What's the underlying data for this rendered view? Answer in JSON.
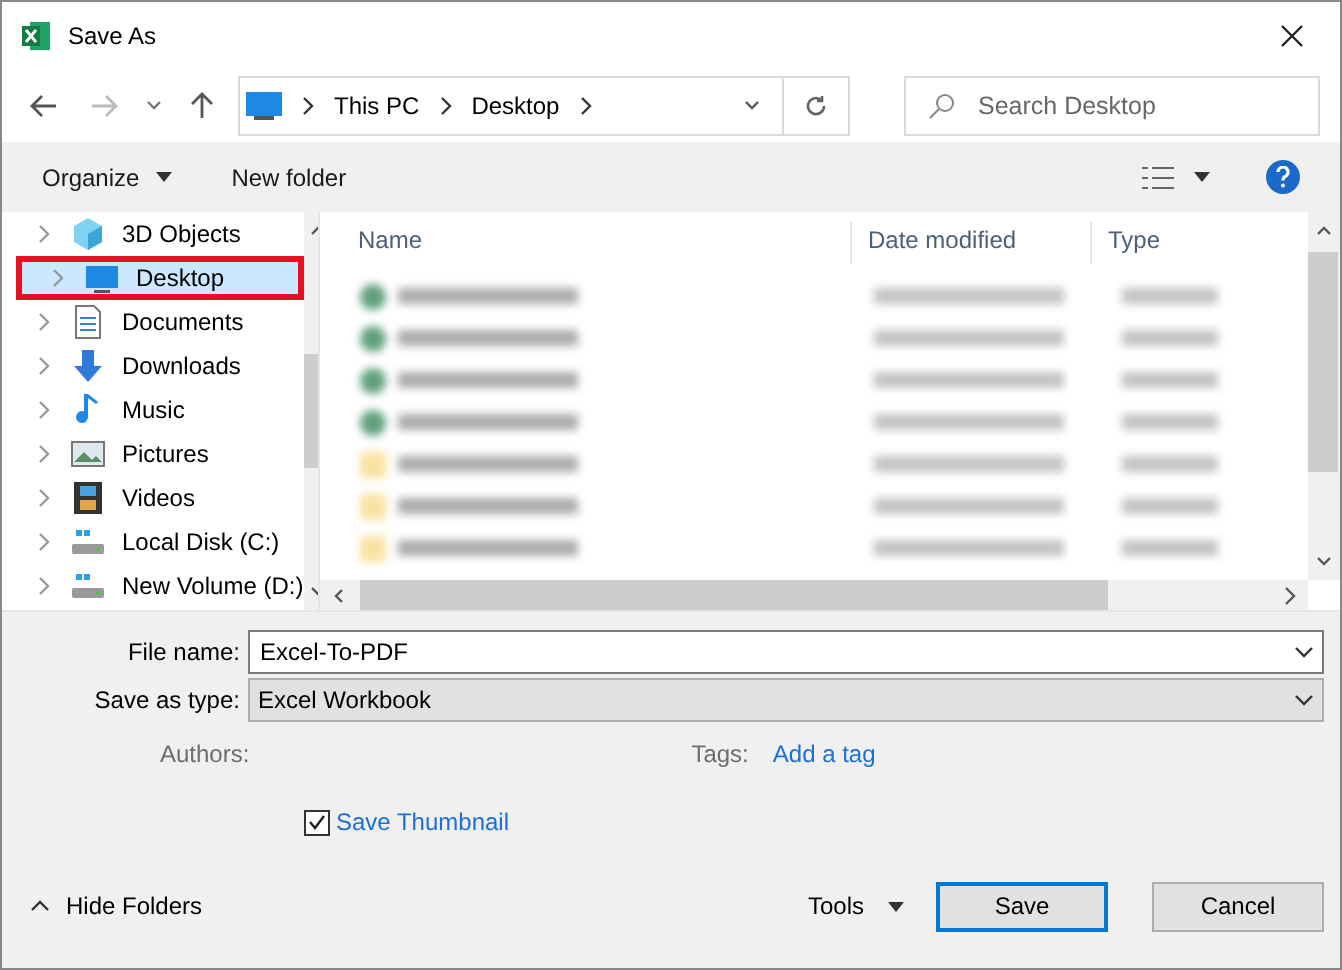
{
  "window": {
    "title": "Save As"
  },
  "address": {
    "path": [
      "This PC",
      "Desktop"
    ]
  },
  "search": {
    "placeholder": "Search Desktop"
  },
  "toolbar": {
    "organize": "Organize",
    "new_folder": "New folder"
  },
  "nav": [
    {
      "label": "3D Objects",
      "kind": "cube",
      "selected": false
    },
    {
      "label": "Desktop",
      "kind": "desktop",
      "selected": true
    },
    {
      "label": "Documents",
      "kind": "document",
      "selected": false
    },
    {
      "label": "Downloads",
      "kind": "download",
      "selected": false
    },
    {
      "label": "Music",
      "kind": "music",
      "selected": false
    },
    {
      "label": "Pictures",
      "kind": "picture",
      "selected": false
    },
    {
      "label": "Videos",
      "kind": "video",
      "selected": false
    },
    {
      "label": "Local Disk (C:)",
      "kind": "disk",
      "selected": false
    },
    {
      "label": "New Volume (D:)",
      "kind": "disk",
      "selected": false
    }
  ],
  "columns": [
    "Name",
    "Date modified",
    "Type"
  ],
  "files": [
    {
      "kind": "excel"
    },
    {
      "kind": "excel"
    },
    {
      "kind": "excel"
    },
    {
      "kind": "excel"
    },
    {
      "kind": "folder"
    },
    {
      "kind": "folder"
    },
    {
      "kind": "folder"
    }
  ],
  "form": {
    "file_name_label": "File name:",
    "file_name": "Excel-To-PDF",
    "type_label": "Save as type:",
    "type": "Excel Workbook",
    "authors_label": "Authors:",
    "tags_label": "Tags:",
    "tags_link": "Add a tag",
    "thumbnail": {
      "label": "Save Thumbnail",
      "checked": true
    }
  },
  "footer": {
    "hide_folders": "Hide Folders",
    "tools": "Tools",
    "buttons": [
      "Save",
      "Cancel"
    ]
  }
}
